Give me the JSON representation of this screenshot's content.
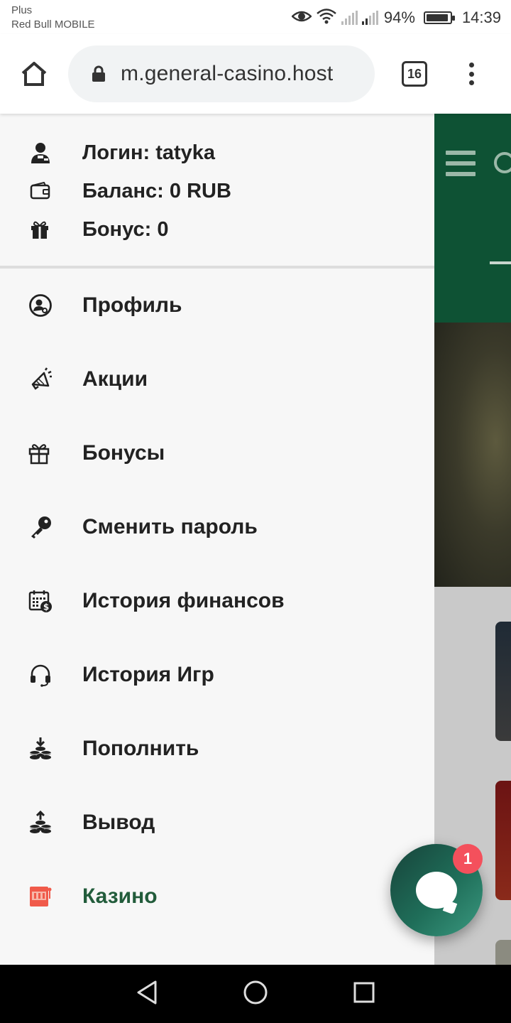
{
  "status_bar": {
    "carrier_line1": "Plus",
    "carrier_line2": "Red Bull MOBILE",
    "battery_percent": "94%",
    "battery_level": 0.94,
    "time": "14:39"
  },
  "browser": {
    "url": "m.general-casino.host",
    "tab_count": "16",
    "icons": [
      "home-icon",
      "lock-icon",
      "tabs-icon",
      "more-vert-icon"
    ]
  },
  "account": {
    "login": "Логин: tatyka",
    "balance": "Баланс: 0 RUB",
    "bonus": "Бонус: 0"
  },
  "menu": {
    "items": [
      {
        "label": "Профиль",
        "icon": "user-circle-icon"
      },
      {
        "label": "Акции",
        "icon": "megaphone-icon"
      },
      {
        "label": "Бонусы",
        "icon": "gift-icon"
      },
      {
        "label": "Сменить пароль",
        "icon": "key-icon"
      },
      {
        "label": "История финансов",
        "icon": "calendar-money-icon"
      },
      {
        "label": "История Игр",
        "icon": "headset-icon"
      },
      {
        "label": "Пополнить",
        "icon": "coins-in-icon"
      },
      {
        "label": "Вывод",
        "icon": "coins-out-icon"
      },
      {
        "label": "Казино",
        "icon": "slot-machine-icon",
        "active": true
      }
    ]
  },
  "chat": {
    "badge_count": "1"
  },
  "colors": {
    "header_green": "#0e5234",
    "active_green": "#225c3b",
    "slot_icon_red": "#f05a4a",
    "badge_red": "#f4505c"
  }
}
